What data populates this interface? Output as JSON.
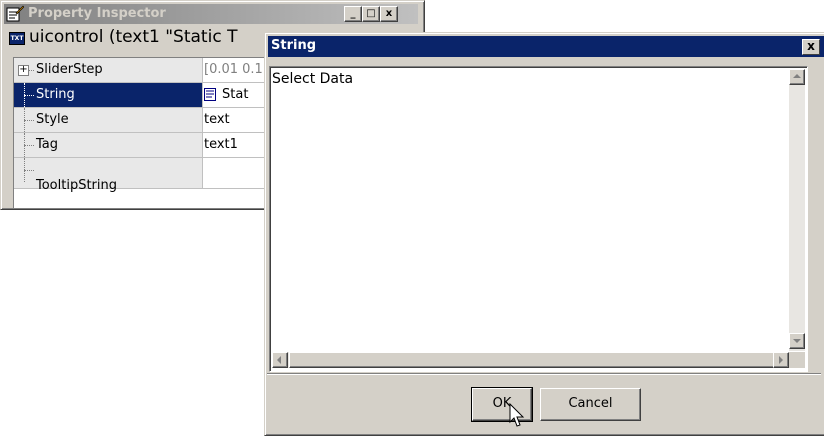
{
  "property_inspector": {
    "title": "Property Inspector",
    "object_label": "uicontrol (text1 \"Static T",
    "badge": "TXT",
    "caption_buttons": [
      "_",
      "□",
      "x"
    ],
    "rows": [
      {
        "name": "SliderStep",
        "value": "[0.01 0.1",
        "expandable": true,
        "selected": false
      },
      {
        "name": "String",
        "value": "Stat",
        "expandable": false,
        "selected": true
      },
      {
        "name": "Style",
        "value": "text",
        "expandable": false,
        "selected": false
      },
      {
        "name": "Tag",
        "value": "text1",
        "expandable": false,
        "selected": false
      },
      {
        "name": "TooltipString",
        "value": "",
        "expandable": false,
        "selected": false
      }
    ]
  },
  "string_dialog": {
    "title": "String",
    "close_label": "x",
    "content": "Select Data",
    "ok_label": "OK",
    "cancel_label": "Cancel"
  },
  "colors": {
    "active_title": "#0a246a",
    "inactive_title": "#808080",
    "face": "#d4d0c8",
    "selection": "#0a246a"
  }
}
